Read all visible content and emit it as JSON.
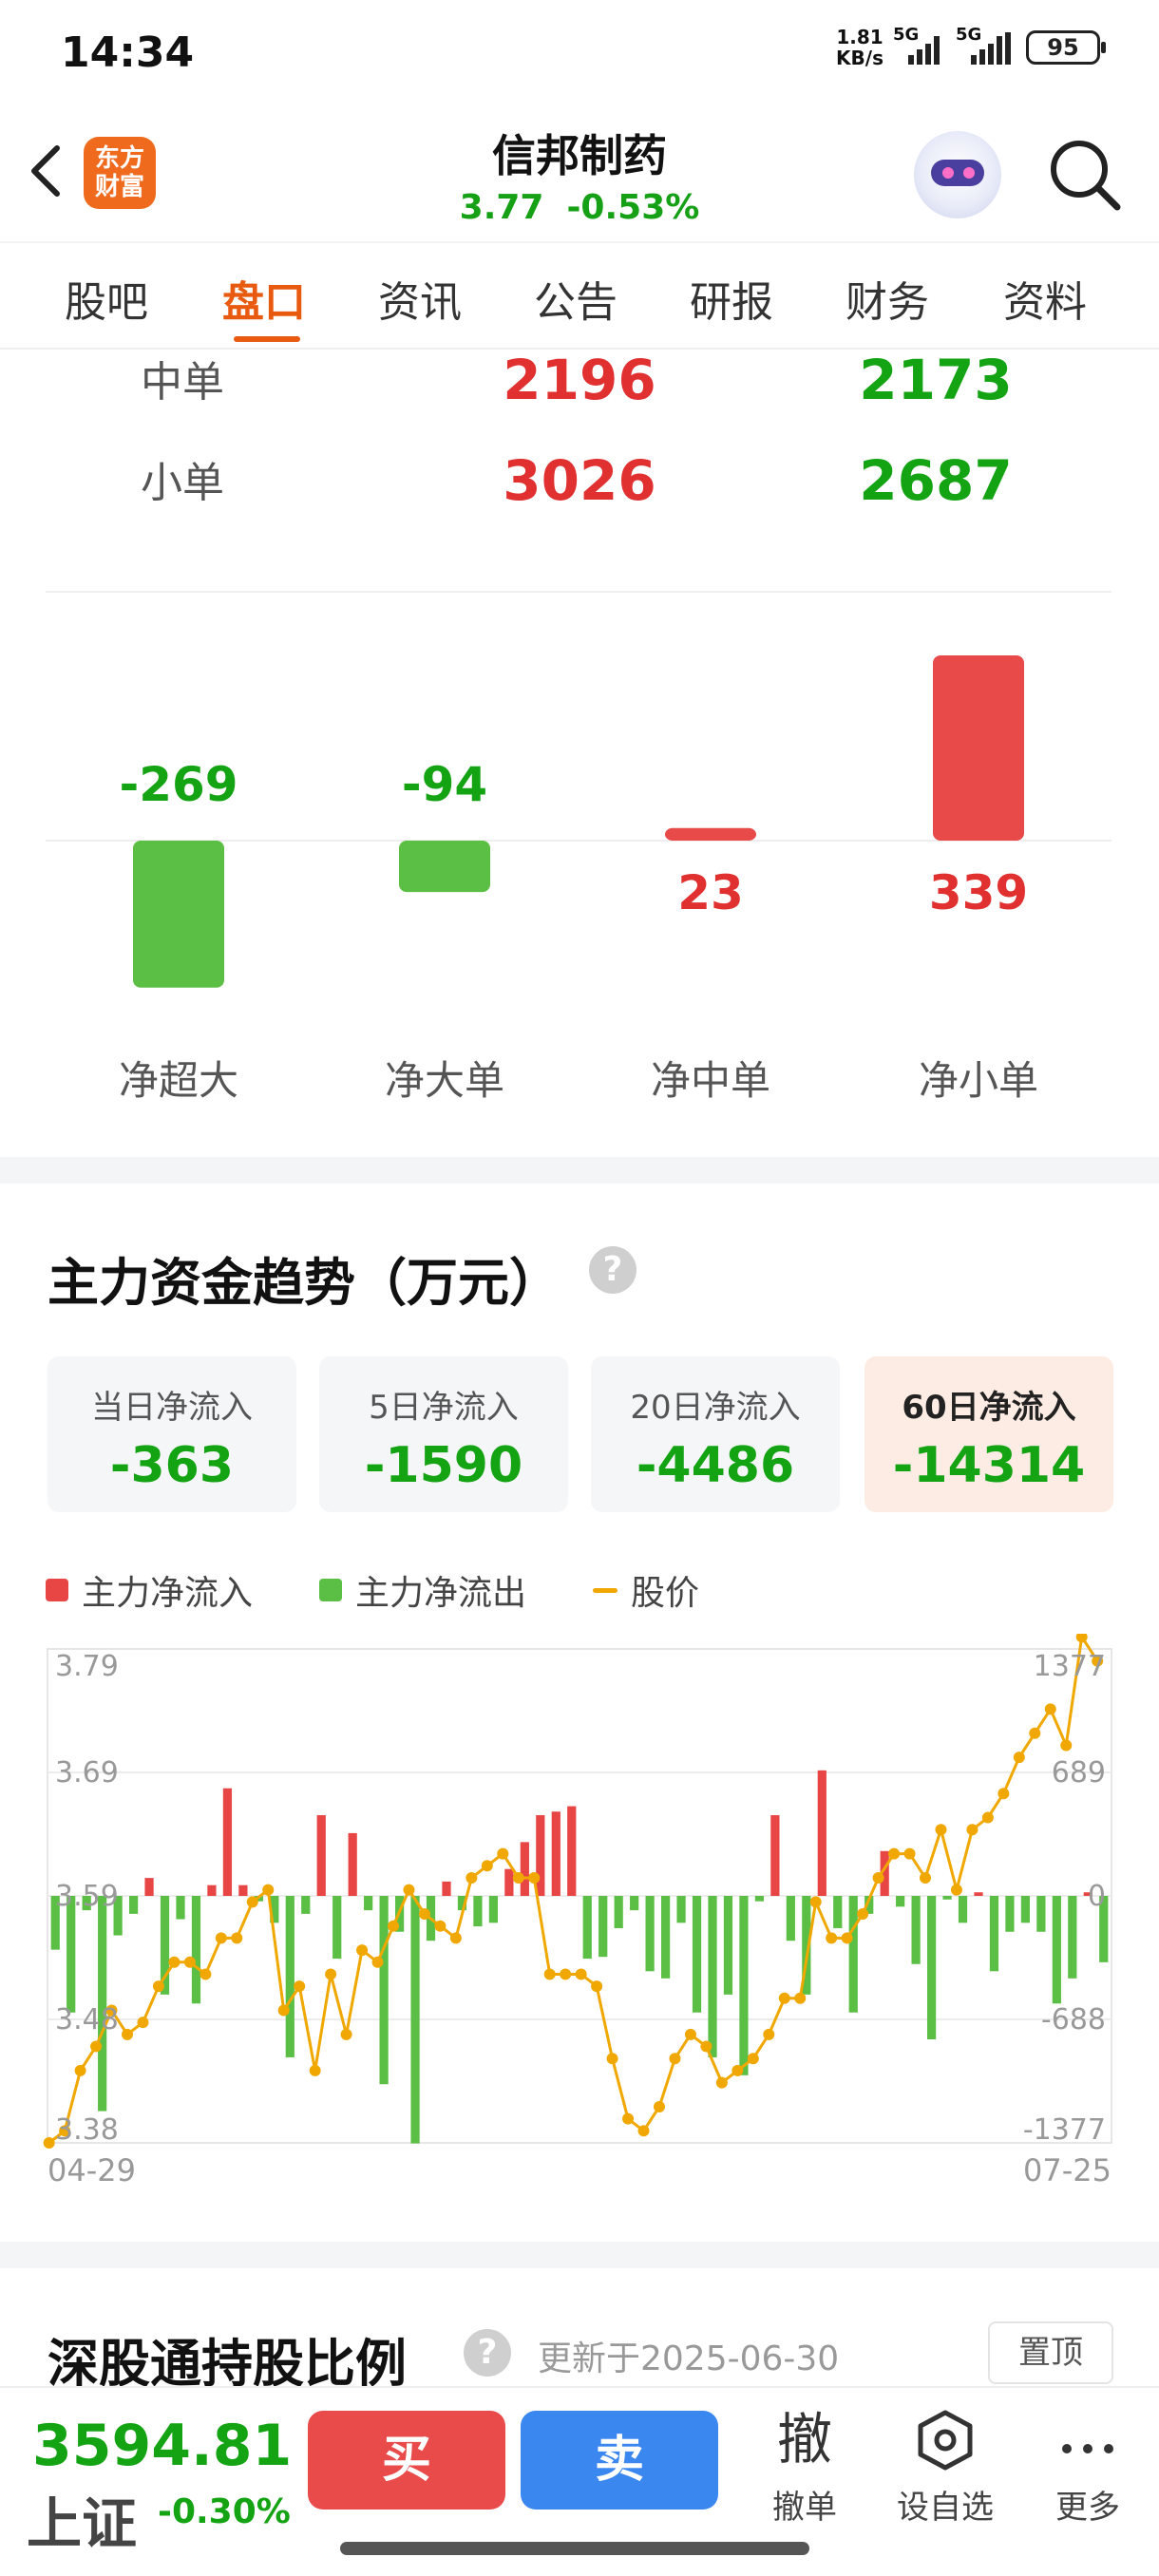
{
  "status": {
    "time": "14:34",
    "net_speed": "1.81",
    "net_unit": "KB/s",
    "sim1": "5G",
    "sim2": "5G",
    "battery": "95"
  },
  "header": {
    "logo_text": "东方财富",
    "stock_name": "信邦制药",
    "price": "3.77",
    "change_pct": "-0.53%"
  },
  "tabs": [
    "股吧",
    "盘口",
    "资讯",
    "公告",
    "研报",
    "财务",
    "资料"
  ],
  "active_tab": 1,
  "orders": [
    {
      "label": "中单",
      "buy": "2196",
      "sell": "2173"
    },
    {
      "label": "小单",
      "buy": "3026",
      "sell": "2687"
    }
  ],
  "net_bars": {
    "categories": [
      "净超大",
      "净大单",
      "净中单",
      "净小单"
    ],
    "values": [
      -269,
      -94,
      23,
      339
    ],
    "value_labels": [
      "-269",
      "-94",
      "23",
      "339"
    ]
  },
  "trend": {
    "title": "主力资金趋势（万元）",
    "help": "?",
    "cards": [
      {
        "label": "当日净流入",
        "value": "-363"
      },
      {
        "label": "5日净流入",
        "value": "-1590"
      },
      {
        "label": "20日净流入",
        "value": "-4486"
      },
      {
        "label": "60日净流入",
        "value": "-14314"
      }
    ],
    "active_card": 3,
    "legend": {
      "inflow": "主力净流入",
      "outflow": "主力净流出",
      "price": "股价"
    }
  },
  "chart_data": {
    "type": "bar+line",
    "x_start_label": "04-29",
    "x_end_label": "07-25",
    "left_axis_ticks": [
      "3.79",
      "3.69",
      "3.59",
      "3.48",
      "3.38"
    ],
    "right_axis_ticks": [
      "1377",
      "689",
      "0",
      "-688",
      "-1377"
    ],
    "y_left_range": [
      3.38,
      3.79
    ],
    "y_right_range": [
      -1377,
      1377
    ],
    "series": [
      {
        "name": "主力净流入 / 主力净流出",
        "values": [
          -300,
          -650,
          -80,
          -1200,
          -220,
          -100,
          100,
          -550,
          -130,
          -600,
          60,
          600,
          60,
          -30,
          -150,
          -900,
          -100,
          450,
          -350,
          350,
          -80,
          -1050,
          -200,
          -1380,
          -250,
          80,
          -80,
          -170,
          -150,
          150,
          300,
          450,
          470,
          500,
          -350,
          -340,
          -180,
          -80,
          -420,
          -460,
          -150,
          -650,
          -900,
          -550,
          -1000,
          -30,
          450,
          -250,
          -550,
          700,
          -180,
          -650,
          -100,
          250,
          -60,
          -380,
          -800,
          -20,
          -150,
          20,
          -420,
          -200,
          -150,
          -200,
          -600,
          -460,
          20,
          -370
        ],
        "colors_positive": "#e84545",
        "colors_negative": "#5cbf45"
      },
      {
        "name": "股价",
        "values": [
          3.38,
          3.39,
          3.44,
          3.46,
          3.49,
          3.47,
          3.48,
          3.51,
          3.53,
          3.53,
          3.52,
          3.55,
          3.55,
          3.58,
          3.59,
          3.49,
          3.51,
          3.44,
          3.52,
          3.47,
          3.54,
          3.53,
          3.56,
          3.59,
          3.57,
          3.56,
          3.55,
          3.6,
          3.61,
          3.62,
          3.6,
          3.6,
          3.52,
          3.52,
          3.52,
          3.51,
          3.45,
          3.4,
          3.39,
          3.41,
          3.45,
          3.47,
          3.46,
          3.43,
          3.44,
          3.45,
          3.47,
          3.5,
          3.5,
          3.58,
          3.55,
          3.55,
          3.57,
          3.6,
          3.62,
          3.62,
          3.6,
          3.64,
          3.59,
          3.64,
          3.65,
          3.67,
          3.7,
          3.72,
          3.74,
          3.71,
          3.8,
          3.78
        ]
      }
    ]
  },
  "hk_section": {
    "title": "深股通持股比例",
    "help": "?",
    "updated": "更新于2025-06-30",
    "pin": "置顶"
  },
  "bottom": {
    "index_value": "3594.81",
    "index_name": "上证",
    "index_change": "-0.30%",
    "buy": "买",
    "sell": "卖",
    "cancel_icon": "撤",
    "cancel_label": "撤单",
    "watch_label": "设自选",
    "more_label": "更多"
  },
  "colors": {
    "up": "#e03030",
    "down": "#13a313",
    "accent": "#e85a10",
    "price_line": "#f0a800"
  }
}
